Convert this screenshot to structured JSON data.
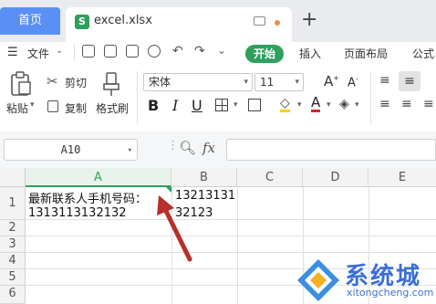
{
  "tabs": {
    "home": "首页",
    "file": "excel.xlsx",
    "file_logo": "S"
  },
  "menu": {
    "file_menu": "文件",
    "start": "开始",
    "insert": "插入",
    "page_layout": "页面布局",
    "formula": "公式"
  },
  "ribbon": {
    "paste": "粘贴",
    "cut": "剪切",
    "copy": "复制",
    "format_painter": "格式刷",
    "font_name": "宋体",
    "font_size": "11"
  },
  "formula_bar": {
    "cell_ref": "A10",
    "fx_label": "fx",
    "formula": ""
  },
  "sheet": {
    "columns": [
      "A",
      "B",
      "C",
      "D",
      "E"
    ],
    "rows": [
      "1",
      "2",
      "3",
      "4",
      "5",
      "6"
    ],
    "cells": {
      "A1_line1": "最新联系人手机号码：",
      "A1_line2": "1313113132132",
      "B1_line1": "13213131",
      "B1_line2": "32123"
    }
  },
  "watermark": {
    "title": "系统城",
    "url": "xitongcheng.com"
  },
  "colors": {
    "accent": "#2ea05c",
    "home_tab": "#5a8ff5",
    "arrow": "#b8302a",
    "watermark": "#3b6fd6"
  }
}
